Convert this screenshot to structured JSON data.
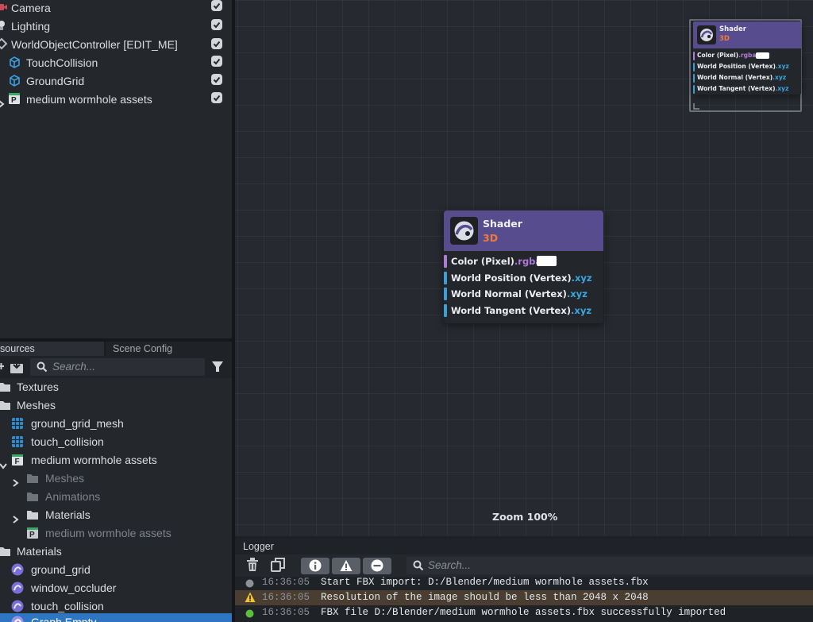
{
  "scene_tree": {
    "items": [
      {
        "label": "Camera"
      },
      {
        "label": "Lighting"
      },
      {
        "label": "WorldObjectController [EDIT_ME]"
      },
      {
        "label": "TouchCollision"
      },
      {
        "label": "GroundGrid"
      },
      {
        "label": "medium wormhole assets"
      }
    ]
  },
  "resources": {
    "tabs": [
      {
        "label": "sources"
      },
      {
        "label": "Scene Config"
      }
    ],
    "search_placeholder": "Search...",
    "items": [
      {
        "label": "Textures"
      },
      {
        "label": "Meshes"
      },
      {
        "label": "ground_grid_mesh"
      },
      {
        "label": "touch_collision"
      },
      {
        "label": "medium wormhole assets"
      },
      {
        "label": "Meshes"
      },
      {
        "label": "Animations"
      },
      {
        "label": "Materials"
      },
      {
        "label": "medium wormhole assets"
      },
      {
        "label": "Materials"
      },
      {
        "label": "ground_grid"
      },
      {
        "label": "window_occluder"
      },
      {
        "label": "touch_collision"
      },
      {
        "label": "Graph Empty"
      }
    ]
  },
  "graph": {
    "node": {
      "title": "Shader",
      "subtitle": "3D",
      "ports": [
        {
          "name": "Color (Pixel)",
          "type": ".rgba",
          "type_color": "#b07ad8",
          "bar_color": "#b07ad8"
        },
        {
          "name": "World Position (Vertex)",
          "type": ".xyz",
          "type_color": "#3aa7e0",
          "bar_color": "#3a9fd6"
        },
        {
          "name": "World Normal (Vertex)",
          "type": ".xyz",
          "type_color": "#3aa7e0",
          "bar_color": "#3a9fd6"
        },
        {
          "name": "World Tangent (Vertex)",
          "type": ".xyz",
          "type_color": "#3aa7e0",
          "bar_color": "#3a9fd6"
        }
      ]
    },
    "zoom_label": "Zoom 100%"
  },
  "logger": {
    "title": "Logger",
    "search_placeholder": "Search...",
    "entries": [
      {
        "level": "info",
        "time": "16:36:05",
        "message": "Start FBX import: D:/Blender/medium wormhole assets.fbx"
      },
      {
        "level": "warning",
        "time": "16:36:05",
        "message": "Resolution of the image should be less than 2048 x 2048"
      },
      {
        "level": "success",
        "time": "16:36:05",
        "message": "FBX file D:/Blender/medium wormhole assets.fbx successfully imported"
      }
    ]
  },
  "colors": {
    "accent": "#2f76c2",
    "node_header": "#564c8e",
    "node_subtitle": "#f07a3c",
    "warning_row": "#4a3e33"
  }
}
